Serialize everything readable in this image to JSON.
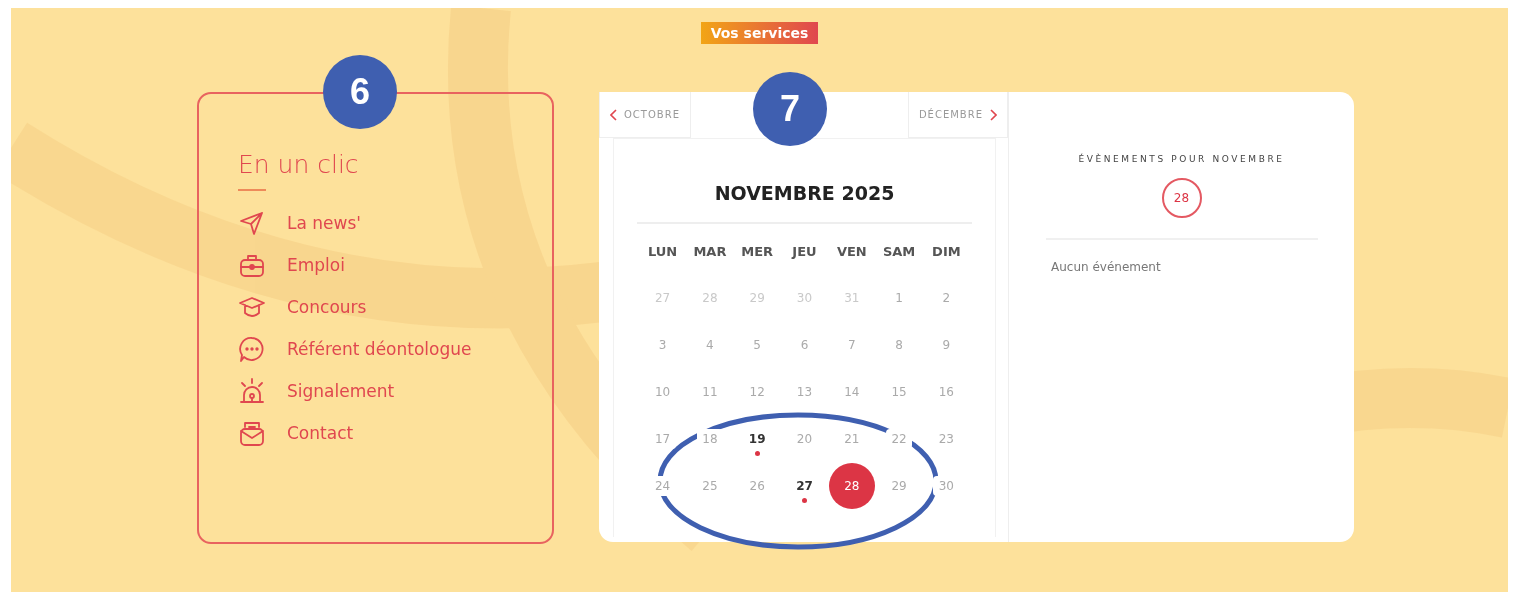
{
  "banner": "Vos services",
  "quick_links": {
    "badge": "6",
    "title": "En un clic",
    "items": [
      "La news'",
      "Emploi",
      "Concours",
      "Référent déontologue",
      "Signalement",
      "Contact"
    ]
  },
  "calendar": {
    "badge": "7",
    "prev": "OCTOBRE",
    "next": "DÉCEMBRE",
    "month": "NOVEMBRE 2025",
    "weekdays": [
      "LUN",
      "MAR",
      "MER",
      "JEU",
      "VEN",
      "SAM",
      "DIM"
    ],
    "days": [
      {
        "label": "27",
        "outside": true,
        "event": false,
        "selected": false
      },
      {
        "label": "28",
        "outside": true,
        "event": false,
        "selected": false
      },
      {
        "label": "29",
        "outside": true,
        "event": false,
        "selected": false
      },
      {
        "label": "30",
        "outside": true,
        "event": false,
        "selected": false
      },
      {
        "label": "31",
        "outside": true,
        "event": false,
        "selected": false
      },
      {
        "label": "1",
        "outside": false,
        "event": false,
        "selected": false
      },
      {
        "label": "2",
        "outside": false,
        "event": false,
        "selected": false
      },
      {
        "label": "3",
        "outside": false,
        "event": false,
        "selected": false
      },
      {
        "label": "4",
        "outside": false,
        "event": false,
        "selected": false
      },
      {
        "label": "5",
        "outside": false,
        "event": false,
        "selected": false
      },
      {
        "label": "6",
        "outside": false,
        "event": false,
        "selected": false
      },
      {
        "label": "7",
        "outside": false,
        "event": false,
        "selected": false
      },
      {
        "label": "8",
        "outside": false,
        "event": false,
        "selected": false
      },
      {
        "label": "9",
        "outside": false,
        "event": false,
        "selected": false
      },
      {
        "label": "10",
        "outside": false,
        "event": false,
        "selected": false
      },
      {
        "label": "11",
        "outside": false,
        "event": false,
        "selected": false
      },
      {
        "label": "12",
        "outside": false,
        "event": false,
        "selected": false
      },
      {
        "label": "13",
        "outside": false,
        "event": false,
        "selected": false
      },
      {
        "label": "14",
        "outside": false,
        "event": false,
        "selected": false
      },
      {
        "label": "15",
        "outside": false,
        "event": false,
        "selected": false
      },
      {
        "label": "16",
        "outside": false,
        "event": false,
        "selected": false
      },
      {
        "label": "17",
        "outside": false,
        "event": false,
        "selected": false
      },
      {
        "label": "18",
        "outside": false,
        "event": false,
        "selected": false
      },
      {
        "label": "19",
        "outside": false,
        "event": true,
        "selected": false
      },
      {
        "label": "20",
        "outside": false,
        "event": false,
        "selected": false
      },
      {
        "label": "21",
        "outside": false,
        "event": false,
        "selected": false
      },
      {
        "label": "22",
        "outside": false,
        "event": false,
        "selected": false
      },
      {
        "label": "23",
        "outside": false,
        "event": false,
        "selected": false
      },
      {
        "label": "24",
        "outside": false,
        "event": false,
        "selected": false
      },
      {
        "label": "25",
        "outside": false,
        "event": false,
        "selected": false
      },
      {
        "label": "26",
        "outside": false,
        "event": false,
        "selected": false
      },
      {
        "label": "27",
        "outside": false,
        "event": true,
        "selected": false
      },
      {
        "label": "28",
        "outside": false,
        "event": false,
        "selected": true
      },
      {
        "label": "29",
        "outside": false,
        "event": false,
        "selected": false
      },
      {
        "label": "30",
        "outside": false,
        "event": false,
        "selected": false
      }
    ]
  },
  "events": {
    "title": "ÉVÈNEMENTS POUR NOVEMBRE",
    "day": "28",
    "empty": "Aucun événement"
  }
}
